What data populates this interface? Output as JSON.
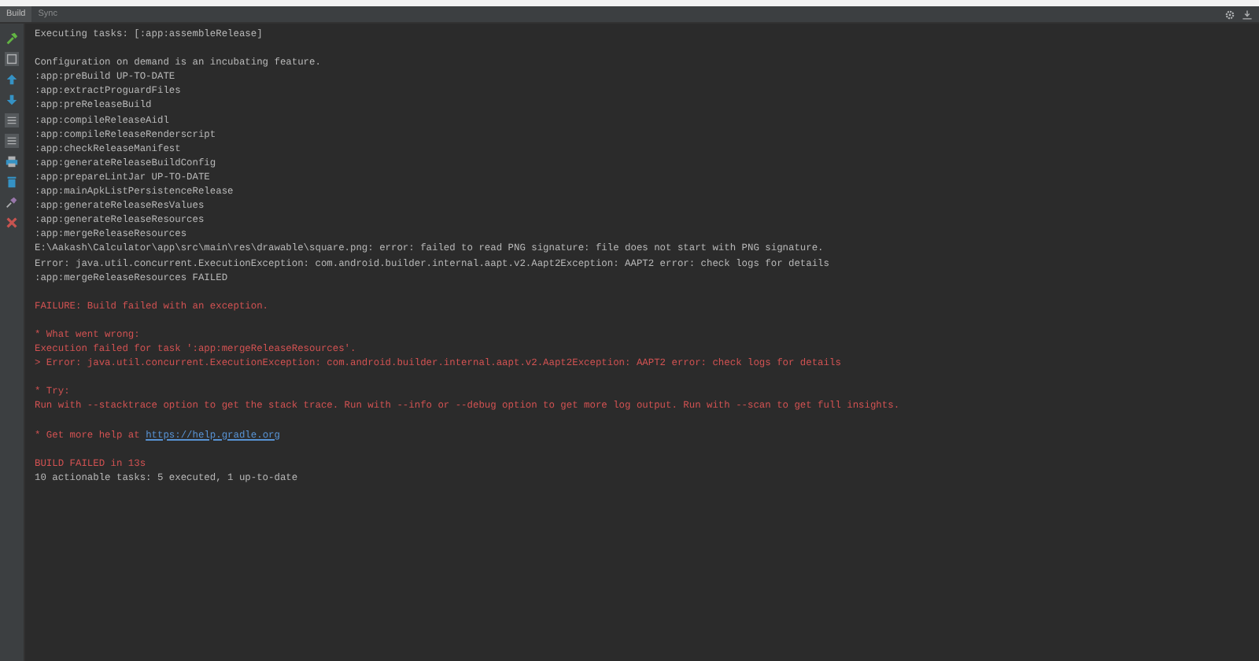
{
  "tabs": [
    {
      "label": "Build",
      "selected": true
    },
    {
      "label": "Sync",
      "selected": false
    }
  ],
  "toolbar": [
    {
      "kind": "hammer"
    },
    {
      "kind": "panel"
    },
    {
      "kind": "up"
    },
    {
      "kind": "down"
    },
    {
      "kind": "list"
    },
    {
      "kind": "list2"
    },
    {
      "kind": "filter"
    },
    {
      "kind": "trash"
    },
    {
      "kind": "pin"
    },
    {
      "kind": "close"
    }
  ],
  "console": [
    {
      "lines": [
        {
          "kind": "plain",
          "text": "Executing tasks: [:app:assembleRelease]"
        }
      ]
    },
    {
      "lines": [
        {
          "kind": "plain",
          "text": "Configuration on demand is an incubating feature."
        },
        {
          "kind": "plain",
          "text": ":app:preBuild UP-TO-DATE"
        },
        {
          "kind": "plain",
          "text": ":app:extractProguardFiles"
        },
        {
          "kind": "plain",
          "text": ":app:preReleaseBuild"
        },
        {
          "kind": "plain",
          "text": ":app:compileReleaseAidl"
        },
        {
          "kind": "plain",
          "text": ":app:compileReleaseRenderscript"
        },
        {
          "kind": "plain",
          "text": ":app:checkReleaseManifest"
        },
        {
          "kind": "plain",
          "text": ":app:generateReleaseBuildConfig"
        },
        {
          "kind": "plain",
          "text": ":app:prepareLintJar UP-TO-DATE"
        },
        {
          "kind": "plain",
          "text": ":app:mainApkListPersistenceRelease"
        },
        {
          "kind": "plain",
          "text": ":app:generateReleaseResValues"
        },
        {
          "kind": "plain",
          "text": ":app:generateReleaseResources"
        },
        {
          "kind": "plain",
          "text": ":app:mergeReleaseResources"
        },
        {
          "kind": "plain",
          "text": "E:\\Aakash\\Calculator\\app\\src\\main\\res\\drawable\\square.png: error: failed to read PNG signature: file does not start with PNG signature."
        },
        {
          "kind": "plain",
          "text": "Error: java.util.concurrent.ExecutionException: com.android.builder.internal.aapt.v2.Aapt2Exception: AAPT2 error: check logs for details"
        },
        {
          "kind": "plain",
          "text": ":app:mergeReleaseResources FAILED"
        }
      ]
    },
    {
      "lines": [
        {
          "kind": "error",
          "text": "FAILURE: Build failed with an exception."
        }
      ]
    },
    {
      "lines": [
        {
          "kind": "error",
          "text": "* What went wrong:"
        },
        {
          "kind": "error",
          "text": "Execution failed for task ':app:mergeReleaseResources'."
        },
        {
          "kind": "error",
          "text": "> Error: java.util.concurrent.ExecutionException: com.android.builder.internal.aapt.v2.Aapt2Exception: AAPT2 error: check logs for details"
        }
      ]
    },
    {
      "lines": [
        {
          "kind": "error",
          "text": "* Try:"
        },
        {
          "kind": "error",
          "text": "Run with --stacktrace option to get the stack trace. Run with --info or --debug option to get more log output. Run with --scan to get full insights."
        }
      ]
    },
    {
      "lines": [
        {
          "kind": "link",
          "text": "* Get more help at ",
          "link": "https://help.gradle.org"
        }
      ]
    },
    {
      "lines": [
        {
          "kind": "error",
          "text": "BUILD FAILED in 13s"
        },
        {
          "kind": "plain",
          "text": "10 actionable tasks: 5 executed, 1 up-to-date"
        }
      ]
    }
  ]
}
